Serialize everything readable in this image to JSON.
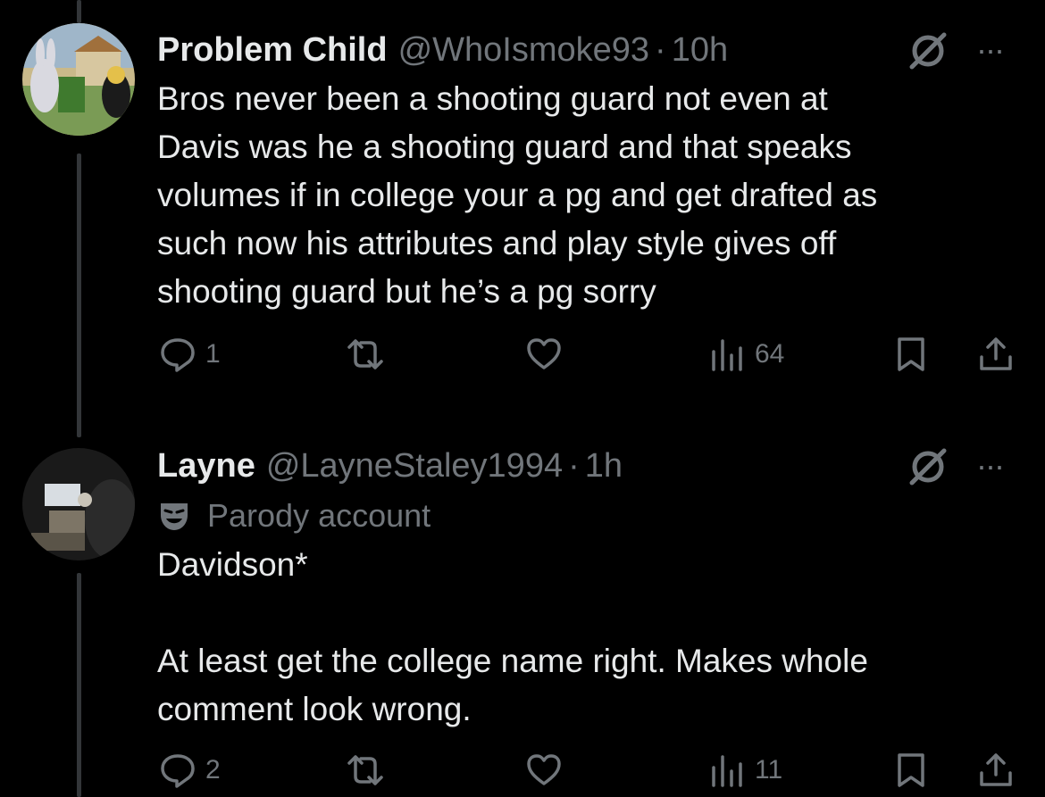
{
  "tweets": [
    {
      "name": "Problem Child",
      "handle": "@WhoIsmoke93",
      "separator": "·",
      "time": "10h",
      "text": "Bros never been a shooting guard not even at\nDavis was he a shooting guard and that speaks\nvolumes if in college your a pg and get drafted as\nsuch now his attributes and play style gives off\nshooting guard but he’s a pg sorry",
      "more_label": "···",
      "replies": "1",
      "views": "64",
      "icons": [
        "reply-icon",
        "retweet-icon",
        "like-icon",
        "views-icon",
        "bookmark-icon",
        "share-icon"
      ]
    },
    {
      "name": "Layne",
      "handle": "@LayneStaley1994",
      "separator": "·",
      "time": "1h",
      "parody_label": "Parody account",
      "text": "Davidson*\n\nAt least get the college name right. Makes whole\ncomment look wrong.",
      "more_label": "···",
      "replies": "2",
      "views": "11",
      "icons": [
        "reply-icon",
        "retweet-icon",
        "like-icon",
        "views-icon",
        "bookmark-icon",
        "share-icon"
      ]
    }
  ],
  "colors": {
    "background": "#000000",
    "text": "#e7e9ea",
    "secondary": "#71767b",
    "thread_line": "#333639"
  }
}
